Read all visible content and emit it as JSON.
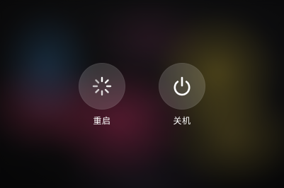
{
  "power_menu": {
    "restart": {
      "label": "重启",
      "icon": "restart-spinner-icon"
    },
    "power_off": {
      "label": "关机",
      "icon": "power-icon"
    }
  },
  "colors": {
    "button_fill": "#ffffff",
    "text": "#ffffff"
  }
}
